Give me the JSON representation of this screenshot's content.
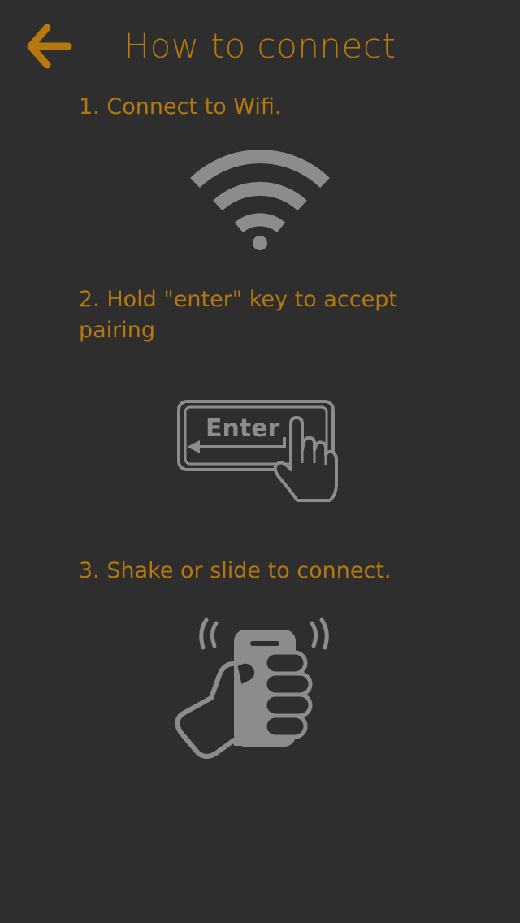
{
  "header": {
    "title": "How to connect",
    "back_icon": "arrow-left-icon"
  },
  "steps": [
    {
      "text": "1. Connect to Wifi.",
      "icon": "wifi-icon"
    },
    {
      "text": "2. Hold \"enter\" key to accept pairing",
      "icon": "enter-key-press-icon",
      "key_label": "Enter"
    },
    {
      "text": "3. Shake or slide to connect.",
      "icon": "shake-phone-icon"
    }
  ],
  "colors": {
    "background": "#2e2e2e",
    "accent": "#b5780f",
    "icon_gray": "#8c8c8c"
  }
}
